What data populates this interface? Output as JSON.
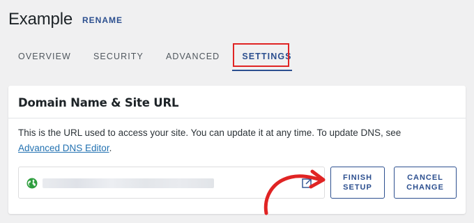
{
  "header": {
    "site_title": "Example",
    "rename_label": "RENAME"
  },
  "tabs": [
    {
      "label": "OVERVIEW",
      "active": false
    },
    {
      "label": "SECURITY",
      "active": false
    },
    {
      "label": "ADVANCED",
      "active": false
    },
    {
      "label": "SETTINGS",
      "active": true
    }
  ],
  "card": {
    "title": "Domain Name & Site URL",
    "description": "This is the URL used to access your site. You can update it at any time. To update DNS, see",
    "dns_link_label": "Advanced DNS Editor",
    "description_end": ".",
    "url_field": {
      "leading_icon": "globe-icon",
      "trailing_icon": "open-external-icon"
    },
    "finish_button": {
      "line1": "FINISH",
      "line2": "SETUP"
    },
    "cancel_button": {
      "line1": "CANCEL",
      "line2": "CHANGE"
    }
  },
  "colors": {
    "background": "#f0f0f1",
    "accent": "#2c4f8f",
    "link": "#2271b1",
    "annotation_red": "#e02424",
    "globe_green": "#2e9e3e"
  }
}
